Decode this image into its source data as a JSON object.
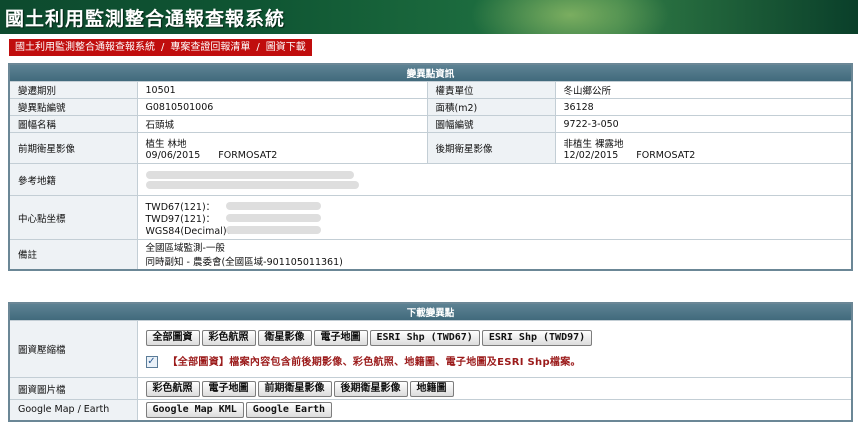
{
  "app": {
    "title": "國土利用監測整合通報查報系統"
  },
  "breadcrumb": [
    {
      "label": "國土利用監測整合通報查報系統"
    },
    {
      "label": "專案查證回報清單"
    },
    {
      "label": "圖資下載"
    }
  ],
  "breadcrumb_sep": "/",
  "info": {
    "header": "變異點資訊",
    "period_label": "變遷期別",
    "period_value": "10501",
    "unit_label": "權責單位",
    "unit_value": "冬山鄉公所",
    "point_id_label": "變異點編號",
    "point_id_value": "G0810501006",
    "area_label": "面積(m2)",
    "area_value": "36128",
    "map_name_label": "圖幅名稱",
    "map_name_value": "石頭城",
    "map_id_label": "圖幅編號",
    "map_id_value": "9722-3-050",
    "pre_label": "前期衛星影像",
    "pre_type": "植生 林地",
    "pre_date": "09/06/2015",
    "pre_sat": "FORMOSAT2",
    "post_label": "後期衛星影像",
    "post_type": "非植生 裸露地",
    "post_date": "12/02/2015",
    "post_sat": "FORMOSAT2",
    "address_label": "參考地籍",
    "center_label": "中心點坐標",
    "twd67_label": "TWD67(121)：",
    "twd97_label": "TWD97(121)：",
    "wgs84_label": "WGS84(Decimal)：",
    "remark_label": "備註",
    "remark_line1": "全國區域監測-一般",
    "remark_line2": "同時副知 - 農委會(全國區域-901105011361)"
  },
  "download": {
    "header": "下載變異點",
    "compressed_label": "圖資壓縮檔",
    "compressed_buttons": [
      "全部圖資",
      "彩色航照",
      "衛星影像",
      "電子地圖",
      "ESRI Shp (TWD67)",
      "ESRI Shp (TWD97)"
    ],
    "note": "【全部圖資】檔案內容包含前後期影像、彩色航照、地籍圖、電子地圖及ESRI Shp檔案。",
    "image_label": "圖資圖片檔",
    "image_buttons": [
      "彩色航照",
      "電子地圖",
      "前期衛星影像",
      "後期衛星影像",
      "地籍圖"
    ],
    "google_label": "Google Map / Earth",
    "google_buttons": [
      "Google Map KML",
      "Google Earth"
    ]
  },
  "colors": {
    "banner": "#0f5533",
    "breadcrumb": "#c00d0d",
    "header": "#4f7789",
    "note": "#9b1b1b"
  }
}
